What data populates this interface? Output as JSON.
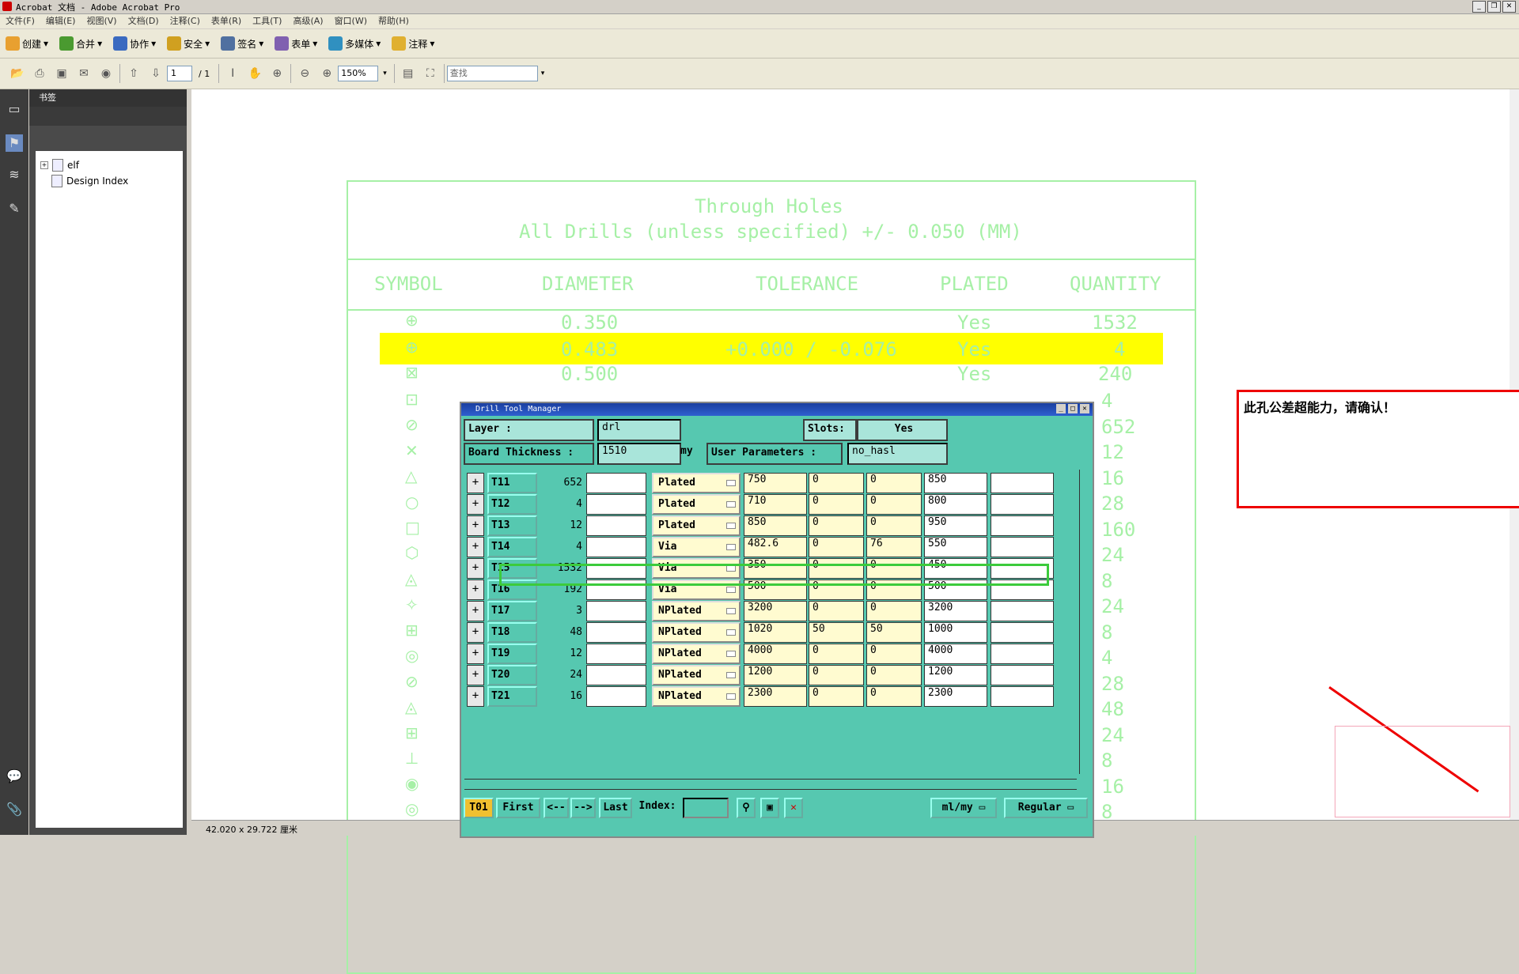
{
  "window": {
    "title": "Acrobat 文档 - Adobe Acrobat Pro"
  },
  "menu": [
    "文件(F)",
    "编辑(E)",
    "视图(V)",
    "文档(D)",
    "注释(C)",
    "表单(R)",
    "工具(T)",
    "高级(A)",
    "窗口(W)",
    "帮助(H)"
  ],
  "toolbar": {
    "create": "创建",
    "combine": "合并",
    "collaborate": "协作",
    "secure": "安全",
    "sign": "签名",
    "forms": "表单",
    "multimedia": "多媒体",
    "comment": "注释"
  },
  "nav": {
    "page": "1",
    "page_total": "/ 1",
    "zoom": "150%",
    "find_placeholder": "查找"
  },
  "bookmarks": {
    "header": "书签",
    "items": [
      "elf",
      "Design Index"
    ]
  },
  "status": {
    "page_size": "42.020 x 29.722 厘米"
  },
  "drawing": {
    "title": "Through Holes",
    "subtitle": "All Drills (unless specified) +/- 0.050 (MM)",
    "headers": [
      "SYMBOL",
      "DIAMETER",
      "TOLERANCE",
      "PLATED",
      "QUANTITY"
    ],
    "rows": [
      {
        "diameter": "0.350",
        "tolerance": "",
        "plated": "Yes",
        "quantity": "1532"
      },
      {
        "diameter": "0.483",
        "tolerance": "+0.000 / -0.076",
        "plated": "Yes",
        "quantity": "4"
      },
      {
        "diameter": "0.500",
        "tolerance": "",
        "plated": "Yes",
        "quantity": "240"
      }
    ],
    "quantity_column": [
      "4",
      "652",
      "12",
      "16",
      "28",
      "160",
      "24",
      "8",
      "24",
      "8",
      "4",
      "28",
      "48",
      "24",
      "8",
      "16",
      "8"
    ]
  },
  "comment": {
    "text": "此孔公差超能力，请确认！"
  },
  "drill_tool_manager": {
    "title": "Drill Tool Manager",
    "layer_label": "Layer          :",
    "layer_value": "drl",
    "slots_label": "Slots:",
    "slots_value": "Yes",
    "thickness_label": "Board Thickness :",
    "thickness_value": "1510",
    "thickness_unit": "my",
    "user_params_label": "User Parameters :",
    "user_params_value": "no_hasl",
    "tools": [
      {
        "name": "T11",
        "count": "652",
        "type": "Plated",
        "v1": "750",
        "v2": "0",
        "v3": "0",
        "v4": "850"
      },
      {
        "name": "T12",
        "count": "4",
        "type": "Plated",
        "v1": "710",
        "v2": "0",
        "v3": "0",
        "v4": "800"
      },
      {
        "name": "T13",
        "count": "12",
        "type": "Plated",
        "v1": "850",
        "v2": "0",
        "v3": "0",
        "v4": "950"
      },
      {
        "name": "T14",
        "count": "4",
        "type": "Via",
        "v1": "482.6",
        "v2": "0",
        "v3": "76",
        "v4": "550"
      },
      {
        "name": "T15",
        "count": "1532",
        "type": "Via",
        "v1": "350",
        "v2": "0",
        "v3": "0",
        "v4": "450"
      },
      {
        "name": "T16",
        "count": "192",
        "type": "Via",
        "v1": "500",
        "v2": "0",
        "v3": "0",
        "v4": "500"
      },
      {
        "name": "T17",
        "count": "3",
        "type": "NPlated",
        "v1": "3200",
        "v2": "0",
        "v3": "0",
        "v4": "3200"
      },
      {
        "name": "T18",
        "count": "48",
        "type": "NPlated",
        "v1": "1020",
        "v2": "50",
        "v3": "50",
        "v4": "1000"
      },
      {
        "name": "T19",
        "count": "12",
        "type": "NPlated",
        "v1": "4000",
        "v2": "0",
        "v3": "0",
        "v4": "4000"
      },
      {
        "name": "T20",
        "count": "24",
        "type": "NPlated",
        "v1": "1200",
        "v2": "0",
        "v3": "0",
        "v4": "1200"
      },
      {
        "name": "T21",
        "count": "16",
        "type": "NPlated",
        "v1": "2300",
        "v2": "0",
        "v3": "0",
        "v4": "2300"
      }
    ],
    "bottom": {
      "tag": "T01",
      "first": "First",
      "prev": "<--",
      "next": "-->",
      "last": "Last",
      "index_label": "Index:",
      "units": "ml/my",
      "mode": "Regular"
    }
  }
}
